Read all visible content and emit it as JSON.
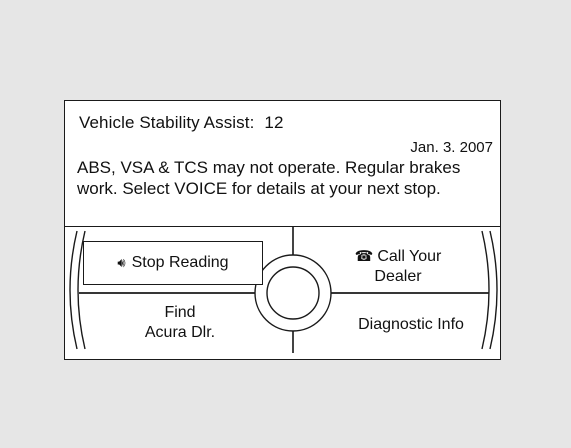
{
  "message": {
    "title": "Vehicle Stability Assist:",
    "code": "12",
    "date": "Jan. 3. 2007",
    "body": "ABS, VSA & TCS may not operate. Regular brakes work. Select VOICE for details at your next stop."
  },
  "menu": {
    "stop_reading": {
      "label": "Stop Reading",
      "icon": "speaker-icon"
    },
    "call_dealer": {
      "label_line1": "Call Your",
      "label_line2": "Dealer",
      "icon": "phone-icon"
    },
    "find_dealer": {
      "label_line1": "Find",
      "label_line2": "Acura Dlr."
    },
    "diagnostic": {
      "label": "Diagnostic Info"
    }
  }
}
